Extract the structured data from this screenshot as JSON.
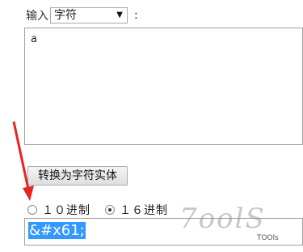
{
  "form": {
    "input_label": "输入",
    "select_value": "字符",
    "colon": ":",
    "textarea_value": "a"
  },
  "convert_button": "转换为字符实体",
  "radix": {
    "options": [
      {
        "label": "１０进制",
        "selected": false
      },
      {
        "label": "１６进制",
        "selected": true
      }
    ]
  },
  "result_value": "&#x61;",
  "watermark": {
    "logo_text": "7oolS",
    "label": "TOOls"
  },
  "colors": {
    "selection": "#3399ff",
    "arrow": "#e52424"
  }
}
